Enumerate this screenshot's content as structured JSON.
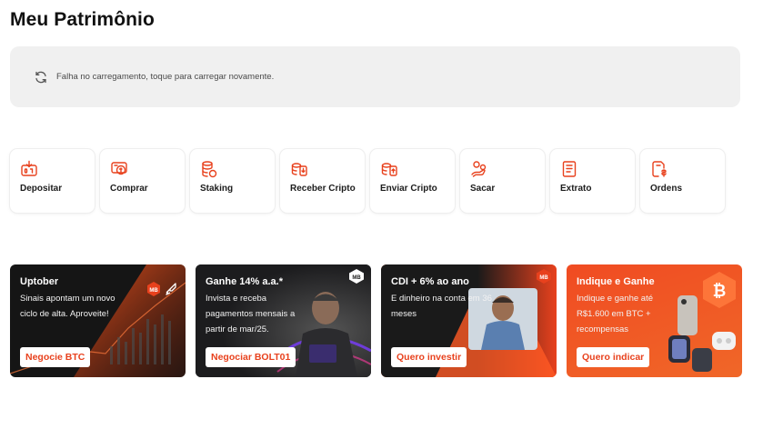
{
  "header": {
    "title": "Meu Patrimônio"
  },
  "error": {
    "message": "Falha no carregamento, toque para carregar novamente.",
    "icon": "refresh-icon"
  },
  "colors": {
    "accent": "#e8411d",
    "card_dark": "#151515",
    "error_bg": "#f0f0f0"
  },
  "actions": [
    {
      "label": "Depositar",
      "icon": "deposit-icon"
    },
    {
      "label": "Comprar",
      "icon": "buy-icon"
    },
    {
      "label": "Staking",
      "icon": "staking-icon"
    },
    {
      "label": "Receber Cripto",
      "icon": "receive-crypto-icon"
    },
    {
      "label": "Enviar Cripto",
      "icon": "send-crypto-icon"
    },
    {
      "label": "Sacar",
      "icon": "withdraw-icon"
    },
    {
      "label": "Extrato",
      "icon": "statement-icon"
    },
    {
      "label": "Ordens",
      "icon": "orders-icon"
    }
  ],
  "promos": [
    {
      "title": "Uptober",
      "line1": "Sinais apontam um novo",
      "line2": "ciclo de alta. Aproveite!",
      "cta": "Negocie BTC",
      "badge": "MB"
    },
    {
      "title": "Ganhe 14% a.a.*",
      "line1": "Invista e receba",
      "line2": "pagamentos mensais a",
      "line3": "partir de mar/25.",
      "cta": "Negociar BOLT01",
      "badge": "MB"
    },
    {
      "title": "CDI + 6% ao ano",
      "line1": "E dinheiro na conta em 36",
      "line2": "meses",
      "cta": "Quero investir",
      "badge": "MB"
    },
    {
      "title": "Indique e Ganhe",
      "line1": "Indique e ganhe até",
      "line2": "R$1.600 em BTC +",
      "line3": "recompensas",
      "cta": "Quero indicar"
    }
  ]
}
